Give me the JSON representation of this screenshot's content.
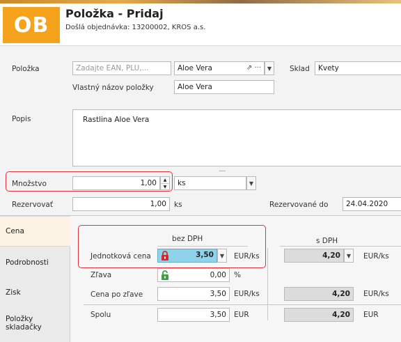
{
  "header": {
    "logo": "OB",
    "title": "Položka - Pridaj",
    "subtitle": "Došlá objednávka: 13200002, KROS a.s."
  },
  "form": {
    "item_label": "Položka",
    "item_code_placeholder": "Zadajte EAN, PLU,...",
    "item_name": "Aloe Vera",
    "warehouse_label": "Sklad",
    "warehouse_value": "Kvety",
    "custom_name_label": "Vlastný názov položky",
    "custom_name_value": "Aloe Vera",
    "description_label": "Popis",
    "description_value": "Rastlina Aloe Vera",
    "resize_grip": ".....",
    "quantity_label": "Množstvo",
    "quantity_value": "1,00",
    "unit_value": "ks",
    "reserve_label": "Rezervovať",
    "reserve_value": "1,00",
    "reserve_unit": "ks",
    "reserved_until_label": "Rezervované do",
    "reserved_until_value": "24.04.2020"
  },
  "tabs": [
    "Cena",
    "Podrobnosti",
    "Zisk",
    "Položky skladačky"
  ],
  "price": {
    "excl_vat_header": "bez DPH",
    "incl_vat_header": "s DPH",
    "unit_price_label": "Jednotková cena",
    "unit_price_value": "3,50",
    "unit_price_unit": "EUR/ks",
    "unit_price_vat_value": "4,20",
    "unit_price_vat_unit": "EUR/ks",
    "discount_label": "Zľava",
    "discount_value": "0,00",
    "discount_unit": "%",
    "after_discount_label": "Cena po zľave",
    "after_discount_value": "3,50",
    "after_discount_unit": "EUR/ks",
    "after_discount_vat_value": "4,20",
    "after_discount_vat_unit": "EUR/ks",
    "total_label": "Spolu",
    "total_value": "3,50",
    "total_unit": "EUR",
    "total_vat_value": "4,20",
    "total_vat_unit": "EUR"
  },
  "colors": {
    "accent": "#f5a31c",
    "highlight_field": "#8fd3ea",
    "annotation": "#e0323c",
    "lock_red": "#d9262e",
    "lock_green": "#3aa33a"
  }
}
